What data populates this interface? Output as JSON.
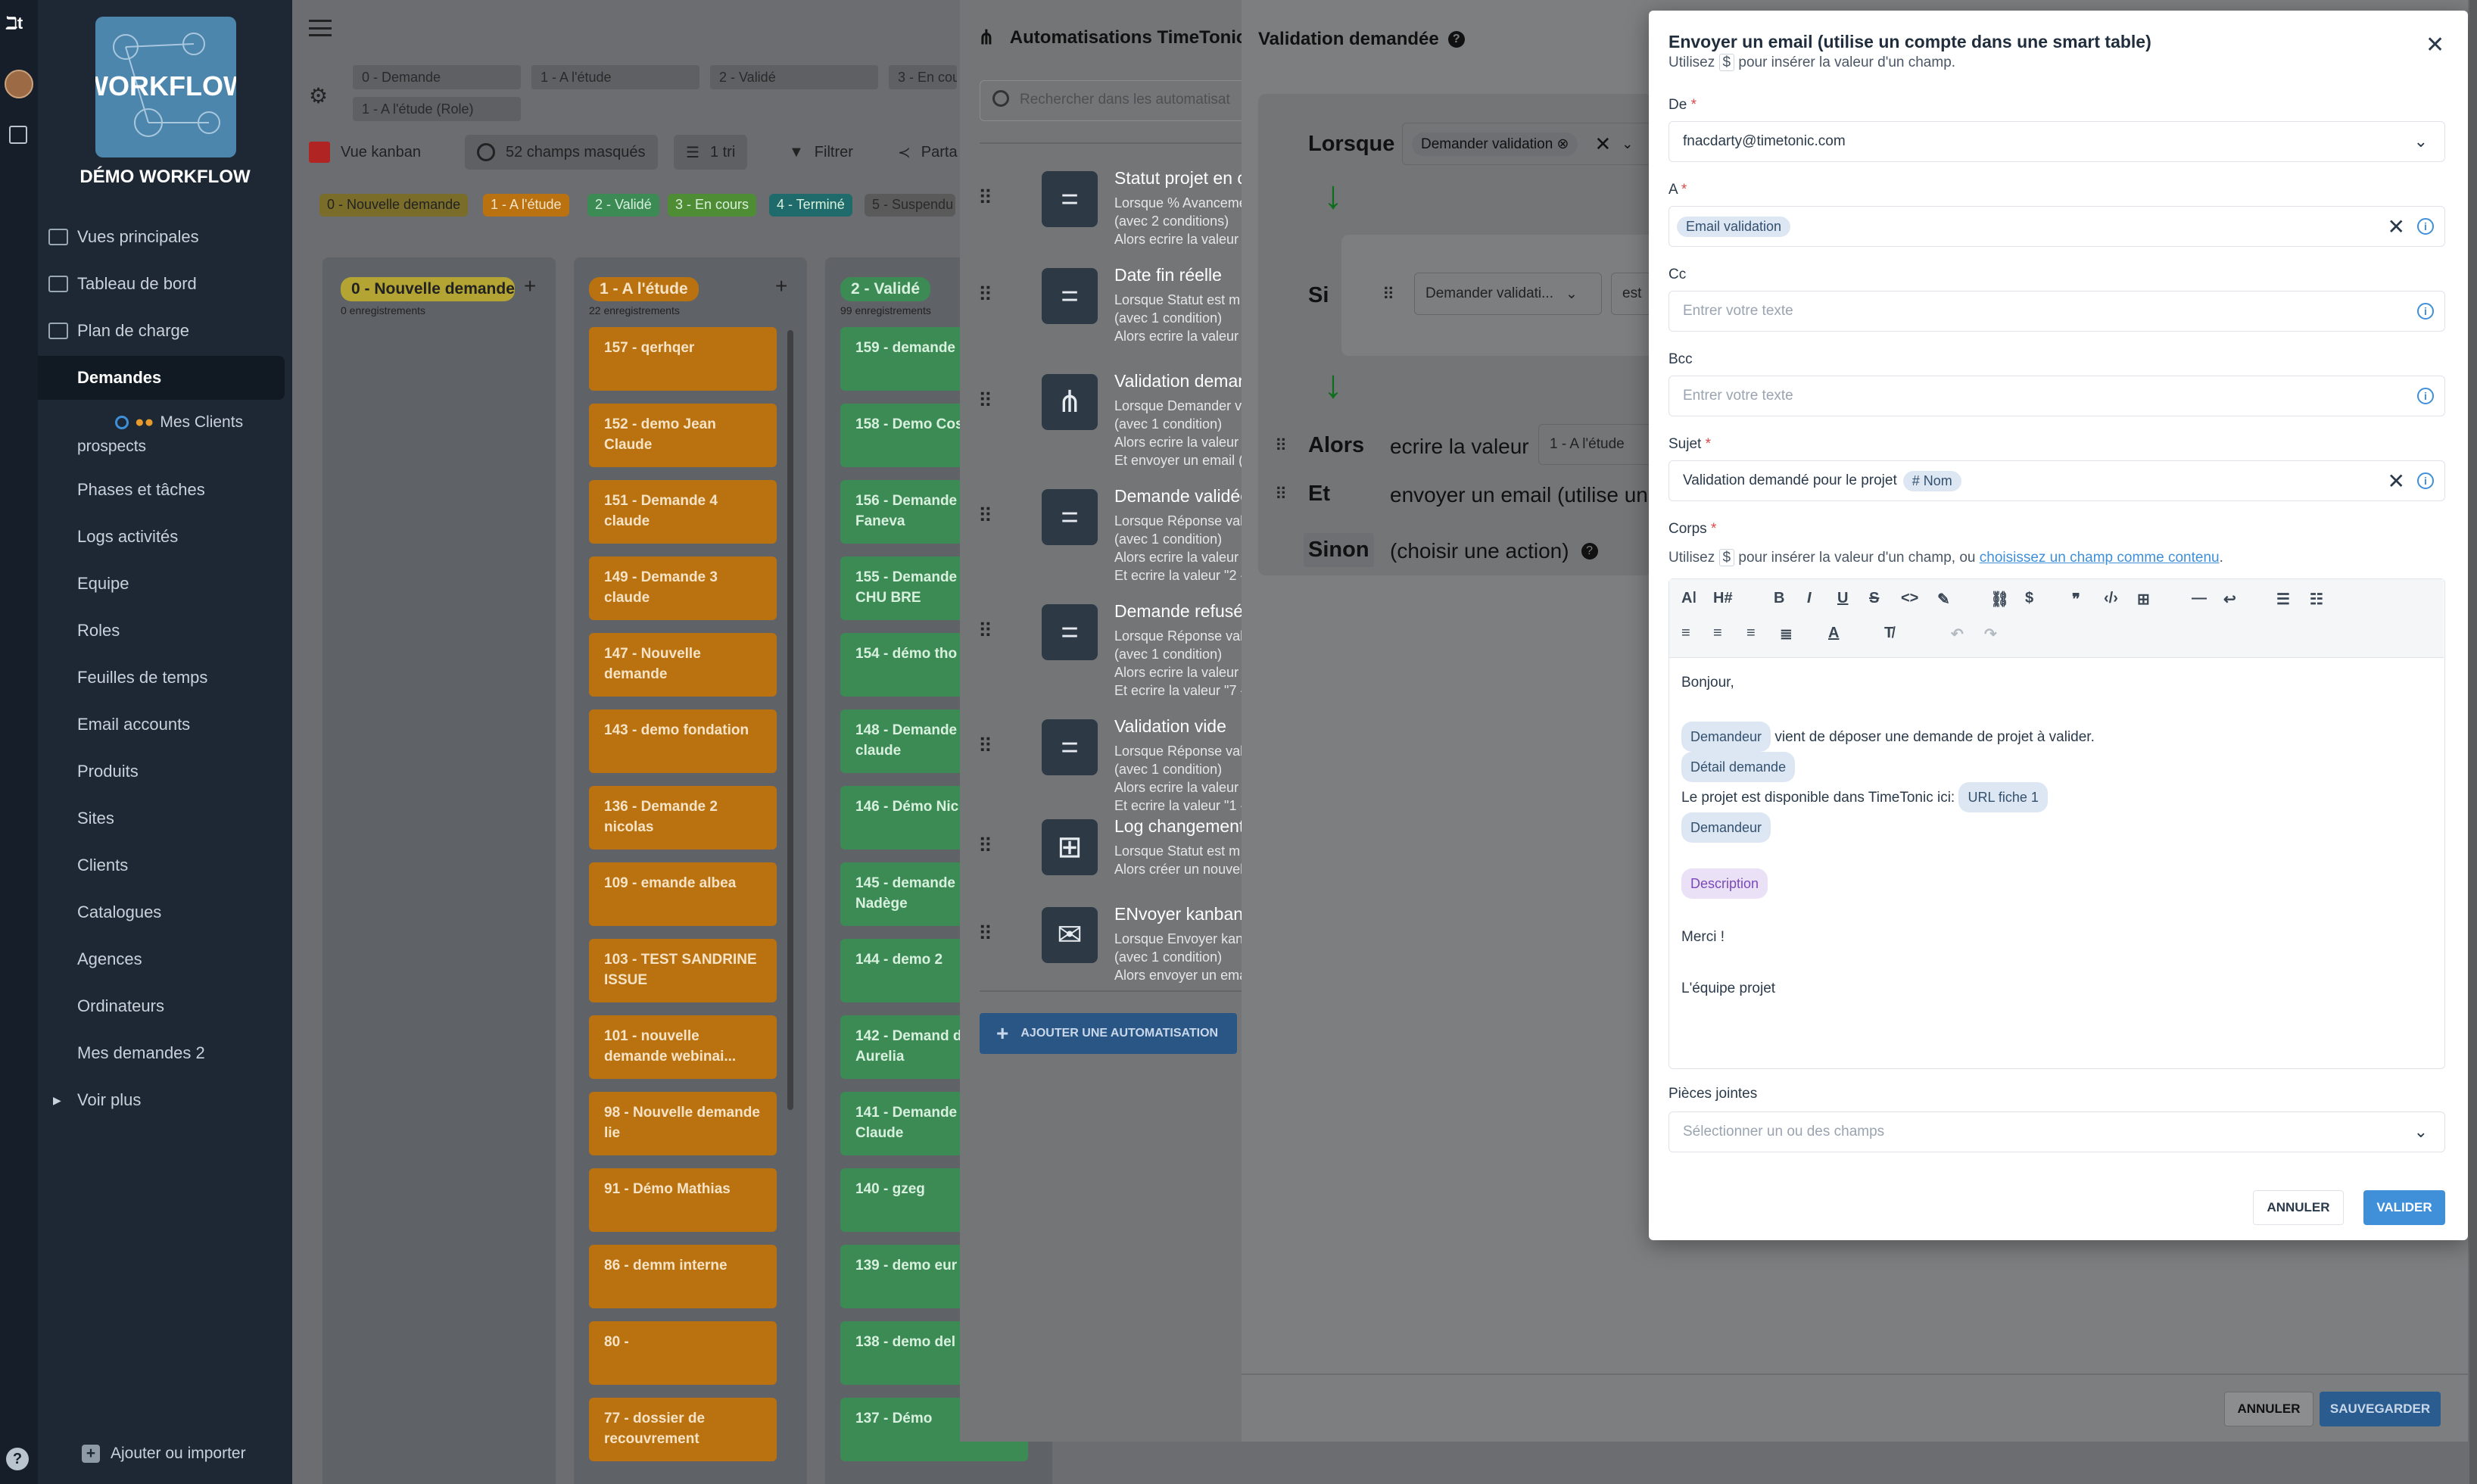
{
  "sidebar": {
    "workspace_name": "DÉMO WORKFLOW",
    "logo_text": "WORKFLOW",
    "items": [
      {
        "label": "Vues principales"
      },
      {
        "label": "Tableau de bord"
      },
      {
        "label": "Plan de charge"
      },
      {
        "label": "Demandes"
      },
      {
        "label": "Mes Clients prospects"
      },
      {
        "label": "Phases et tâches"
      },
      {
        "label": "Logs activités"
      },
      {
        "label": "Equipe"
      },
      {
        "label": "Roles"
      },
      {
        "label": "Feuilles de temps"
      },
      {
        "label": "Email accounts"
      },
      {
        "label": "Produits"
      },
      {
        "label": "Sites"
      },
      {
        "label": "Clients"
      },
      {
        "label": "Catalogues"
      },
      {
        "label": "Agences"
      },
      {
        "label": "Ordinateurs"
      },
      {
        "label": "Mes demandes 2"
      },
      {
        "label": "Voir plus"
      }
    ],
    "add_import": "Ajouter ou importer"
  },
  "board": {
    "filters": [
      "0 - Demande",
      "1 - A l'étude",
      "2 - Validé",
      "3 - En cou",
      "1 - A l'étude (Role)"
    ],
    "toolbar": {
      "kanban": "Vue kanban",
      "hidden": "52 champs masqués",
      "sort": "1 tri",
      "filter": "Filtrer",
      "share": "Parta"
    },
    "legend": [
      "0 - Nouvelle demande",
      "1 - A l'étude",
      "2 - Validé",
      "3 - En cours",
      "4 - Terminé",
      "5 - Suspendu"
    ],
    "columns": [
      {
        "title": "0 - Nouvelle demande",
        "count": "0 enregistrements",
        "cards": []
      },
      {
        "title": "1 - A l'étude",
        "count": "22 enregistrements",
        "cards": [
          "157 - qerhqer",
          "152 - demo Jean Claude",
          "151 - Demande 4 claude",
          "149 - Demande 3 claude",
          "147 - Nouvelle demande",
          "143 - demo fondation",
          "136 - Demande 2 nicolas",
          "109 - emande albea",
          "103 - TEST SANDRINE ISSUE",
          "101 - nouvelle demande webinai...",
          "98 - Nouvelle demande lie",
          "91 - Démo Mathias",
          "86 - demm interne",
          "80 -",
          "77 - dossier de recouvrement"
        ]
      },
      {
        "title": "2 - Validé",
        "count": "99 enregistrements",
        "cards": [
          "159 - demande",
          "158 - Demo Cosfibel",
          "156 - Demande démo Faneva",
          "155 - Demande démo CHU BRE",
          "154 - démo tho",
          "148 - Demande pour claude",
          "146 - Démo Nic",
          "145 - demande demo Nadège",
          "144 - demo 2",
          "142 - Demand demo Aurelia",
          "141 - Demande crédit Claude",
          "140 - gzeg",
          "139 - demo eur",
          "138 - demo del",
          "137 - Démo"
        ]
      }
    ]
  },
  "automations": {
    "title": "Automatisations TimeTonic",
    "search_placeholder": "Rechercher dans les automatisat",
    "items": [
      {
        "title": "Statut projet en co",
        "lines": [
          "Lorsque % Avanceme",
          "(avec 2 conditions)",
          "Alors ecrire la valeur \""
        ],
        "icon": "equals-icon"
      },
      {
        "title": "Date fin réelle",
        "lines": [
          "Lorsque Statut est m",
          "(avec 1 condition)",
          "Alors ecrire la valeur \""
        ],
        "icon": "equals-icon"
      },
      {
        "title": "Validation demand",
        "lines": [
          "Lorsque Demander va",
          "(avec 1 condition)",
          "Alors ecrire la valeur \"",
          "Et envoyer un email (u"
        ],
        "icon": "workflow-icon"
      },
      {
        "title": "Demande validée",
        "lines": [
          "Lorsque Réponse vali",
          "(avec 1 condition)",
          "Alors ecrire la valeur \"",
          "Et ecrire la valeur \"2 -"
        ],
        "icon": "equals-icon"
      },
      {
        "title": "Demande refusée",
        "lines": [
          "Lorsque Réponse vali",
          "(avec 1 condition)",
          "Alors ecrire la valeur \"",
          "Et ecrire la valeur \"7 -"
        ],
        "icon": "equals-icon"
      },
      {
        "title": "Validation vide",
        "lines": [
          "Lorsque Réponse vali",
          "(avec 1 condition)",
          "Alors ecrire la valeur \"",
          "Et ecrire la valeur \"1 -"
        ],
        "icon": "equals-icon"
      },
      {
        "title": "Log changement d",
        "lines": [
          "Lorsque Statut est m",
          "Alors créer un nouvel"
        ],
        "icon": "table-add-icon"
      },
      {
        "title": "ENvoyer kanban",
        "lines": [
          "Lorsque Envoyer kanb",
          "(avec 1 condition)",
          "Alors envoyer un ema"
        ],
        "icon": "mail-icon"
      }
    ],
    "add_button": "AJOUTER UNE AUTOMATISATION"
  },
  "validation": {
    "title": "Validation demandée",
    "when_label": "Lorsque",
    "when_value": "Demander validation",
    "if_label": "Si",
    "if_field": "Demander validati...",
    "if_op": "est",
    "then_label": "Alors",
    "then_text": "ecrire la valeur",
    "then_value": "1 - A l'étude",
    "and_label": "Et",
    "and_text": "envoyer un email (utilise un c",
    "else_label": "Sinon",
    "else_text": "(choisir une action)",
    "cancel": "ANNULER",
    "save": "SAUVEGARDER"
  },
  "email": {
    "title": "Envoyer un email (utilise un compte dans une smart table)",
    "subtitle_pre": "Utilisez",
    "subtitle_key": "$",
    "subtitle_post": "pour insérer la valeur d'un champ.",
    "from_label": "De",
    "from_value": "fnacdarty@timetonic.com",
    "to_label": "A",
    "to_tag": "Email validation",
    "cc_label": "Cc",
    "cc_placeholder": "Entrer votre texte",
    "bcc_label": "Bcc",
    "bcc_placeholder": "Entrer votre texte",
    "subject_label": "Sujet",
    "subject_text": "Validation demandé pour le projet",
    "subject_tag": "# Nom",
    "body_label": "Corps",
    "body_hint_pre": "Utilisez",
    "body_hint_key": "$",
    "body_hint_mid": "pour insérer la valeur d'un champ, ou",
    "body_hint_link": "choisissez un champ comme contenu",
    "body": {
      "greeting": "Bonjour,",
      "tag_demandeur": "Demandeur",
      "line1": "vient de déposer une demande de projet à valider.",
      "tag_detail": "Détail demande",
      "line2": "Le projet est disponible dans TimeTonic ici:",
      "tag_url": "URL fiche 1",
      "tag_demandeur2": "Demandeur",
      "tag_description": "Description",
      "thanks": "Merci !",
      "signature": "L'équipe projet"
    },
    "attachments_label": "Pièces jointes",
    "attachments_placeholder": "Sélectionner un ou des champs",
    "cancel": "ANNULER",
    "validate": "VALIDER"
  },
  "colors": {
    "primary": "#3f8fd9",
    "orange": "#e89a2c",
    "green": "#5cb87a",
    "sidebar": "#1d2834"
  }
}
